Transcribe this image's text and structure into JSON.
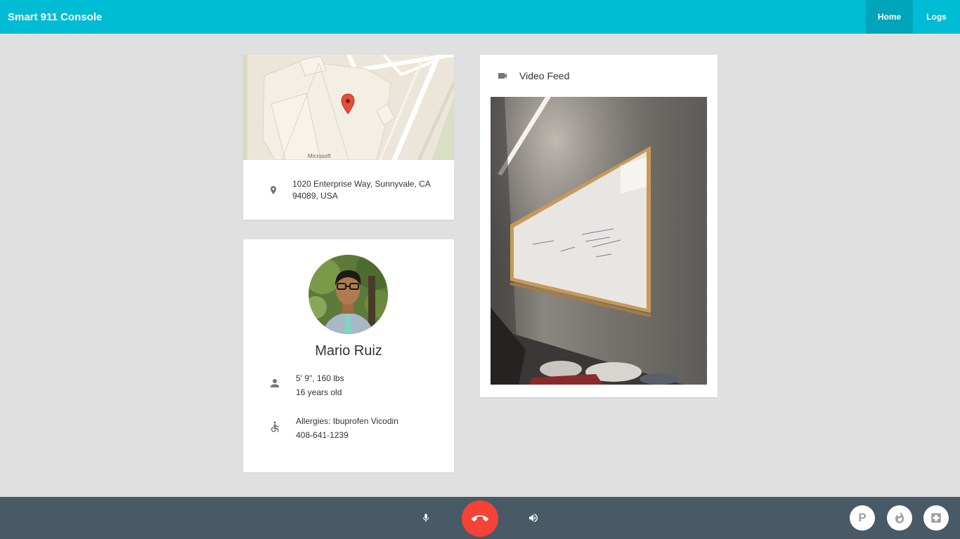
{
  "appbar": {
    "title": "Smart 911 Console",
    "nav": [
      {
        "label": "Home",
        "active": true
      },
      {
        "label": "Logs",
        "active": false
      }
    ]
  },
  "location": {
    "map_attribution": "Microsoft",
    "address": "1020 Enterprise Way, Sunnyvale, CA 94089, USA",
    "pin_color": "#e74c3c"
  },
  "caller": {
    "name": "Mario Ruiz",
    "physical_line1": "5' 9\", 160 lbs",
    "physical_line2": "16 years old",
    "medical_line1": "Allergies: Ibuprofen Vicodin",
    "medical_line2": "408-641-1239"
  },
  "video": {
    "header": "Video Feed"
  },
  "callbar": {
    "police_label": "P",
    "hangup_color": "#f44336"
  },
  "colors": {
    "primary": "#00bcd4",
    "primary_dark": "#00a5bb",
    "callbar": "#485a66",
    "background": "#e0e0e0"
  }
}
